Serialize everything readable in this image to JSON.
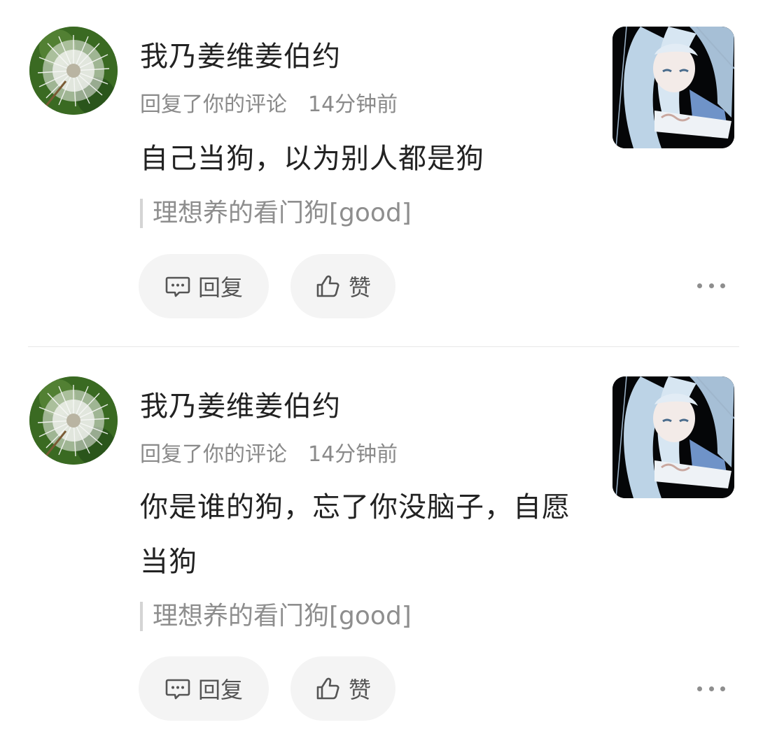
{
  "comments": [
    {
      "username": "我乃姜维姜伯约",
      "action": "回复了你的评论",
      "time": "14分钟前",
      "text": "自己当狗，以为别人都是狗",
      "quoted": "理想养的看门狗[good]",
      "reply_label": "回复",
      "like_label": "赞"
    },
    {
      "username": "我乃姜维姜伯约",
      "action": "回复了你的评论",
      "time": "14分钟前",
      "text": "你是谁的狗，忘了你没脑子，自愿当狗",
      "quoted": "理想养的看门狗[good]",
      "reply_label": "回复",
      "like_label": "赞"
    }
  ],
  "icons": {
    "avatar": "dandelion-avatar",
    "thumbnail": "anime-girl-thumbnail",
    "reply": "comment-bubble-icon",
    "like": "thumbs-up-icon",
    "more": "more-dots-icon"
  }
}
